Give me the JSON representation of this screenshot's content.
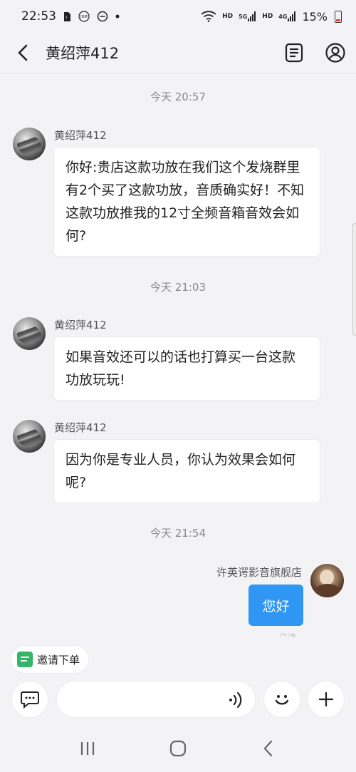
{
  "status_bar": {
    "time": "22:53",
    "hd1": "HD",
    "net1": "5G",
    "hd2": "HD",
    "net2": "4G",
    "battery": "15%"
  },
  "header": {
    "title": "黄绍萍412"
  },
  "chat": {
    "time1": "今天  20:57",
    "time2": "今天  21:03",
    "time3": "今天  21:54",
    "messages": [
      {
        "sender": "黄绍萍412",
        "text": "你好:贵店这款功放在我们这个发烧群里有2个买了这款功放，音质确实好！不知这款功放推我的12寸全频音箱音效会如何?"
      },
      {
        "sender": "黄绍萍412",
        "text": "如果音效还可以的话也打算买一台这款功放玩玩!"
      },
      {
        "sender": "黄绍萍412",
        "text": "因为你是专业人员，你认为效果会如何呢?"
      }
    ],
    "reply": {
      "sender": "许英谔影音旗舰店",
      "text": "您好",
      "status": "已读"
    }
  },
  "invite": {
    "label": "邀请下单"
  },
  "input": {
    "placeholder": ""
  },
  "colors": {
    "accent": "#2f97f3",
    "invite_green": "#34b567",
    "background": "#f3f3f5"
  }
}
